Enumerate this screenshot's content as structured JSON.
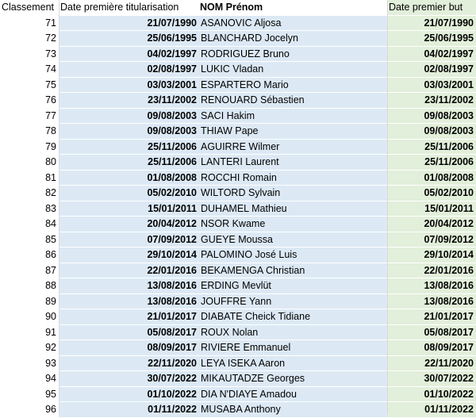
{
  "headers": {
    "rank": "Classement",
    "date_first_start": "Date première titularisation",
    "name": "NOM Prénom",
    "date_first_goal": "Date premier but"
  },
  "rows": [
    {
      "rank": "71",
      "d1": "21/07/1990",
      "name": "ASANOVIC Aljosa",
      "d2": "21/07/1990"
    },
    {
      "rank": "72",
      "d1": "25/06/1995",
      "name": "BLANCHARD Jocelyn",
      "d2": "25/06/1995"
    },
    {
      "rank": "73",
      "d1": "04/02/1997",
      "name": "RODRIGUEZ Bruno",
      "d2": "04/02/1997"
    },
    {
      "rank": "74",
      "d1": "02/08/1997",
      "name": "LUKIC Vladan",
      "d2": "02/08/1997"
    },
    {
      "rank": "75",
      "d1": "03/03/2001",
      "name": "ESPARTERO Mario",
      "d2": "03/03/2001"
    },
    {
      "rank": "76",
      "d1": "23/11/2002",
      "name": "RENOUARD Sébastien",
      "d2": "23/11/2002"
    },
    {
      "rank": "77",
      "d1": "09/08/2003",
      "name": "SACI Hakim",
      "d2": "09/08/2003"
    },
    {
      "rank": "78",
      "d1": "09/08/2003",
      "name": "THIAW Pape",
      "d2": "09/08/2003"
    },
    {
      "rank": "79",
      "d1": "25/11/2006",
      "name": "AGUIRRE Wilmer",
      "d2": "25/11/2006"
    },
    {
      "rank": "80",
      "d1": "25/11/2006",
      "name": "LANTERI Laurent",
      "d2": "25/11/2006"
    },
    {
      "rank": "81",
      "d1": "01/08/2008",
      "name": "ROCCHI Romain",
      "d2": "01/08/2008"
    },
    {
      "rank": "82",
      "d1": "05/02/2010",
      "name": "WILTORD Sylvain",
      "d2": "05/02/2010"
    },
    {
      "rank": "83",
      "d1": "15/01/2011",
      "name": "DUHAMEL Mathieu",
      "d2": "15/01/2011"
    },
    {
      "rank": "84",
      "d1": "20/04/2012",
      "name": "NSOR Kwame",
      "d2": "20/04/2012"
    },
    {
      "rank": "85",
      "d1": "07/09/2012",
      "name": "GUEYE Moussa",
      "d2": "07/09/2012"
    },
    {
      "rank": "86",
      "d1": "29/10/2014",
      "name": "PALOMINO José Luis",
      "d2": "29/10/2014"
    },
    {
      "rank": "87",
      "d1": "22/01/2016",
      "name": "BEKAMENGA Christian",
      "d2": "22/01/2016"
    },
    {
      "rank": "88",
      "d1": "13/08/2016",
      "name": "ERDING Mevlüt",
      "d2": "13/08/2016"
    },
    {
      "rank": "89",
      "d1": "13/08/2016",
      "name": "JOUFFRE Yann",
      "d2": "13/08/2016"
    },
    {
      "rank": "90",
      "d1": "21/01/2017",
      "name": "DIABATE Cheick Tidiane",
      "d2": "21/01/2017"
    },
    {
      "rank": "91",
      "d1": "05/08/2017",
      "name": "ROUX Nolan",
      "d2": "05/08/2017"
    },
    {
      "rank": "92",
      "d1": "08/09/2017",
      "name": "RIVIERE Emmanuel",
      "d2": "08/09/2017"
    },
    {
      "rank": "93",
      "d1": "22/11/2020",
      "name": "LEYA ISEKA Aaron",
      "d2": "22/11/2020"
    },
    {
      "rank": "94",
      "d1": "30/07/2022",
      "name": "MIKAUTADZE Georges",
      "d2": "30/07/2022"
    },
    {
      "rank": "95",
      "d1": "01/10/2022",
      "name": "DIA N'DIAYE Amadou",
      "d2": "01/10/2022"
    },
    {
      "rank": "96",
      "d1": "01/11/2022",
      "name": "MUSABA Anthony",
      "d2": "01/11/2022"
    }
  ]
}
